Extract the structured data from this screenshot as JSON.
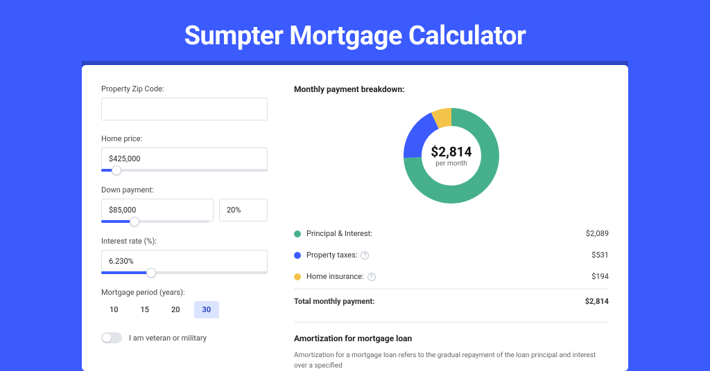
{
  "title": "Sumpter Mortgage Calculator",
  "form": {
    "zip": {
      "label": "Property Zip Code:",
      "value": ""
    },
    "price": {
      "label": "Home price:",
      "value": "$425,000",
      "slider_pct": 9
    },
    "down": {
      "label": "Down payment:",
      "amount": "$85,000",
      "pct": "20%",
      "slider_pct": 20
    },
    "rate": {
      "label": "Interest rate (%):",
      "value": "6.230%",
      "slider_pct": 30
    },
    "period": {
      "label": "Mortgage period (years):",
      "options": [
        "10",
        "15",
        "20",
        "30"
      ],
      "active": "30"
    },
    "veteran": {
      "label": "I am veteran or military",
      "on": false
    }
  },
  "breakdown": {
    "title": "Monthly payment breakdown:",
    "total_amount": "$2,814",
    "total_sub": "per month",
    "items": [
      {
        "label": "Principal & Interest:",
        "value": "$2,089",
        "color": "#46b08c",
        "info": false
      },
      {
        "label": "Property taxes:",
        "value": "$531",
        "color": "#3b5bff",
        "info": true
      },
      {
        "label": "Home insurance:",
        "value": "$194",
        "color": "#f3c44a",
        "info": true
      }
    ],
    "total_row": {
      "label": "Total monthly payment:",
      "value": "$2,814"
    }
  },
  "amort": {
    "title": "Amortization for mortgage loan",
    "text": "Amortization for a mortgage loan refers to the gradual repayment of the loan principal and interest over a specified"
  },
  "chart_data": {
    "type": "pie",
    "title": "Monthly payment breakdown",
    "series": [
      {
        "name": "Principal & Interest",
        "value": 2089,
        "color": "#46b08c"
      },
      {
        "name": "Property taxes",
        "value": 531,
        "color": "#3b5bff"
      },
      {
        "name": "Home insurance",
        "value": 194,
        "color": "#f3c44a"
      }
    ],
    "total": 2814,
    "center_label": "$2,814 per month"
  }
}
